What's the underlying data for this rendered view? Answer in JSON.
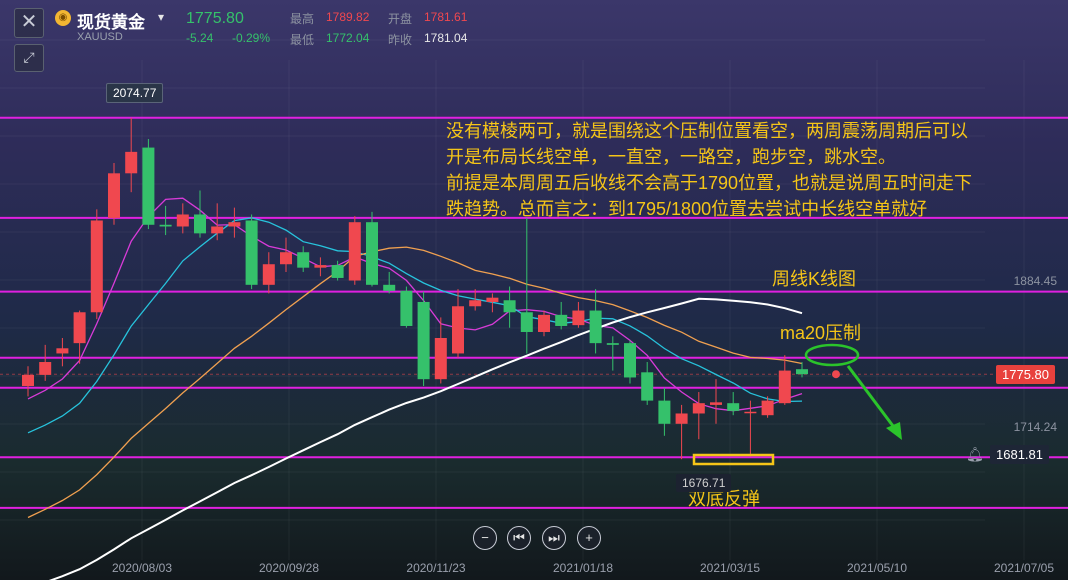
{
  "header": {
    "title": "现货黄金",
    "symbol": "XAUUSD",
    "last_price": "1775.80",
    "change": "-5.24",
    "change_pct": "-0.29%",
    "high_label": "最高",
    "high_value": "1789.82",
    "open_label": "开盘",
    "open_value": "1781.61",
    "low_label": "最低",
    "low_value": "1772.04",
    "prev_close_label": "昨收",
    "prev_close_value": "1781.04",
    "coin_icon": "gold-coin-icon"
  },
  "annotations": {
    "main_text": [
      "没有模棱两可，就是围绕这个压制位置看空，两周震荡周期后可以",
      "开是布局长线空单，一直空，一路空，跑步空，跳水空。",
      "前提是本周周五后收线不会高于1790位置，也就是说周五时间走下",
      "跌趋势。总而言之：到1795/1800位置去尝试中长线空单就好"
    ],
    "weekly_label": "周线K线图",
    "ma20_label": "ma20压制",
    "double_bottom_label": "双底反弹"
  },
  "price_tags": {
    "high_marker": "2074.77",
    "low_marker": "1676.71",
    "current": "1775.80",
    "alert": "1681.81"
  },
  "colors": {
    "up": "#f0484f",
    "down": "#35c16b",
    "annotation": "#f5c518",
    "hline": "#e020e0"
  },
  "chart_data": {
    "type": "candlestick",
    "timeframe": "weekly",
    "y_axis_labels": [
      1884.45,
      1714.24
    ],
    "x_axis_labels": [
      "2020/08/03",
      "2020/09/28",
      "2020/11/23",
      "2021/01/18",
      "2021/03/15",
      "2021/05/10",
      "2021/07/05"
    ],
    "candles": [
      {
        "o": 1762,
        "h": 1785,
        "l": 1750,
        "c": 1775
      },
      {
        "o": 1775,
        "h": 1810,
        "l": 1768,
        "c": 1790
      },
      {
        "o": 1800,
        "h": 1818,
        "l": 1785,
        "c": 1806
      },
      {
        "o": 1812,
        "h": 1850,
        "l": 1788,
        "c": 1848
      },
      {
        "o": 1848,
        "h": 1968,
        "l": 1840,
        "c": 1955
      },
      {
        "o": 1958,
        "h": 2022,
        "l": 1950,
        "c": 2010
      },
      {
        "o": 2010,
        "h": 2074.77,
        "l": 1988,
        "c": 2035
      },
      {
        "o": 2040,
        "h": 2050,
        "l": 1945,
        "c": 1950
      },
      {
        "o": 1950,
        "h": 1972,
        "l": 1938,
        "c": 1948
      },
      {
        "o": 1948,
        "h": 1975,
        "l": 1940,
        "c": 1962
      },
      {
        "o": 1962,
        "h": 1990,
        "l": 1935,
        "c": 1940
      },
      {
        "o": 1940,
        "h": 1975,
        "l": 1932,
        "c": 1948
      },
      {
        "o": 1948,
        "h": 1970,
        "l": 1935,
        "c": 1953
      },
      {
        "o": 1955,
        "h": 1962,
        "l": 1875,
        "c": 1880
      },
      {
        "o": 1880,
        "h": 1918,
        "l": 1870,
        "c": 1904
      },
      {
        "o": 1904,
        "h": 1935,
        "l": 1895,
        "c": 1918
      },
      {
        "o": 1918,
        "h": 1925,
        "l": 1895,
        "c": 1900
      },
      {
        "o": 1900,
        "h": 1912,
        "l": 1890,
        "c": 1903
      },
      {
        "o": 1903,
        "h": 1908,
        "l": 1885,
        "c": 1888
      },
      {
        "o": 1885,
        "h": 1960,
        "l": 1880,
        "c": 1953
      },
      {
        "o": 1953,
        "h": 1965,
        "l": 1878,
        "c": 1880
      },
      {
        "o": 1880,
        "h": 1895,
        "l": 1870,
        "c": 1873
      },
      {
        "o": 1873,
        "h": 1878,
        "l": 1830,
        "c": 1832
      },
      {
        "o": 1860,
        "h": 1872,
        "l": 1762,
        "c": 1770
      },
      {
        "o": 1770,
        "h": 1842,
        "l": 1765,
        "c": 1818
      },
      {
        "o": 1800,
        "h": 1875,
        "l": 1795,
        "c": 1855
      },
      {
        "o": 1855,
        "h": 1875,
        "l": 1850,
        "c": 1862
      },
      {
        "o": 1860,
        "h": 1870,
        "l": 1848,
        "c": 1865
      },
      {
        "o": 1862,
        "h": 1878,
        "l": 1830,
        "c": 1848
      },
      {
        "o": 1848,
        "h": 1958,
        "l": 1800,
        "c": 1825
      },
      {
        "o": 1825,
        "h": 1850,
        "l": 1820,
        "c": 1845
      },
      {
        "o": 1845,
        "h": 1860,
        "l": 1828,
        "c": 1832
      },
      {
        "o": 1833,
        "h": 1860,
        "l": 1830,
        "c": 1850
      },
      {
        "o": 1850,
        "h": 1875,
        "l": 1800,
        "c": 1812
      },
      {
        "o": 1812,
        "h": 1820,
        "l": 1780,
        "c": 1810
      },
      {
        "o": 1812,
        "h": 1815,
        "l": 1765,
        "c": 1772
      },
      {
        "o": 1778,
        "h": 1790,
        "l": 1740,
        "c": 1745
      },
      {
        "o": 1745,
        "h": 1760,
        "l": 1704,
        "c": 1718
      },
      {
        "o": 1718,
        "h": 1740,
        "l": 1676.71,
        "c": 1730
      },
      {
        "o": 1730,
        "h": 1755,
        "l": 1700,
        "c": 1742
      },
      {
        "o": 1740,
        "h": 1770,
        "l": 1718,
        "c": 1743
      },
      {
        "o": 1742,
        "h": 1755,
        "l": 1728,
        "c": 1733
      },
      {
        "o": 1731,
        "h": 1745,
        "l": 1680,
        "c": 1732
      },
      {
        "o": 1728,
        "h": 1750,
        "l": 1725,
        "c": 1745
      },
      {
        "o": 1742,
        "h": 1798,
        "l": 1740,
        "c": 1780
      },
      {
        "o": 1781.61,
        "h": 1789.82,
        "l": 1772.04,
        "c": 1775.8
      }
    ],
    "horizontal_levels": [
      2074.77,
      1958,
      1872,
      1795,
      1760,
      1679,
      1620
    ],
    "moving_averages": [
      "ma5",
      "ma10",
      "ma20",
      "ma60"
    ]
  }
}
